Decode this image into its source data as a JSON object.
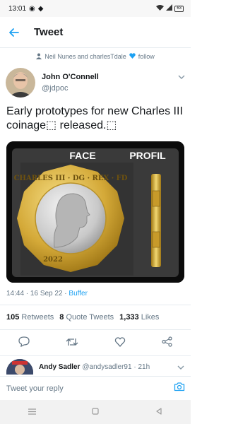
{
  "status_bar": {
    "time": "13:01",
    "battery": "63"
  },
  "header": {
    "title": "Tweet"
  },
  "social_context": {
    "text": "Neil Nunes and charlesTdale",
    "follow_label": "follow"
  },
  "tweet": {
    "author_name": "John O'Connell",
    "author_handle": "@jdpoc",
    "text": "Early prototypes for new Charles III coinage⬚ released.⬚",
    "image_labels": {
      "face": "FACE",
      "profile": "PROFIL"
    },
    "coin": {
      "inscription": "CHARLES III · DG · REX · FD",
      "year": "2022"
    },
    "timestamp": "14:44 · 16 Sep 22 ·",
    "via": "Buffer"
  },
  "stats": {
    "retweets_count": "105",
    "retweets_label": "Retweets",
    "quotes_count": "8",
    "quotes_label": "Quote Tweets",
    "likes_count": "1,333",
    "likes_label": "Likes"
  },
  "reply_preview": {
    "name": "Andy Sadler",
    "handle": "@andysadler91 · 21h"
  },
  "composer": {
    "placeholder": "Tweet your reply"
  },
  "colors": {
    "accent": "#1da1f2",
    "heart": "#1da1f2",
    "secondary_text": "#657786"
  }
}
